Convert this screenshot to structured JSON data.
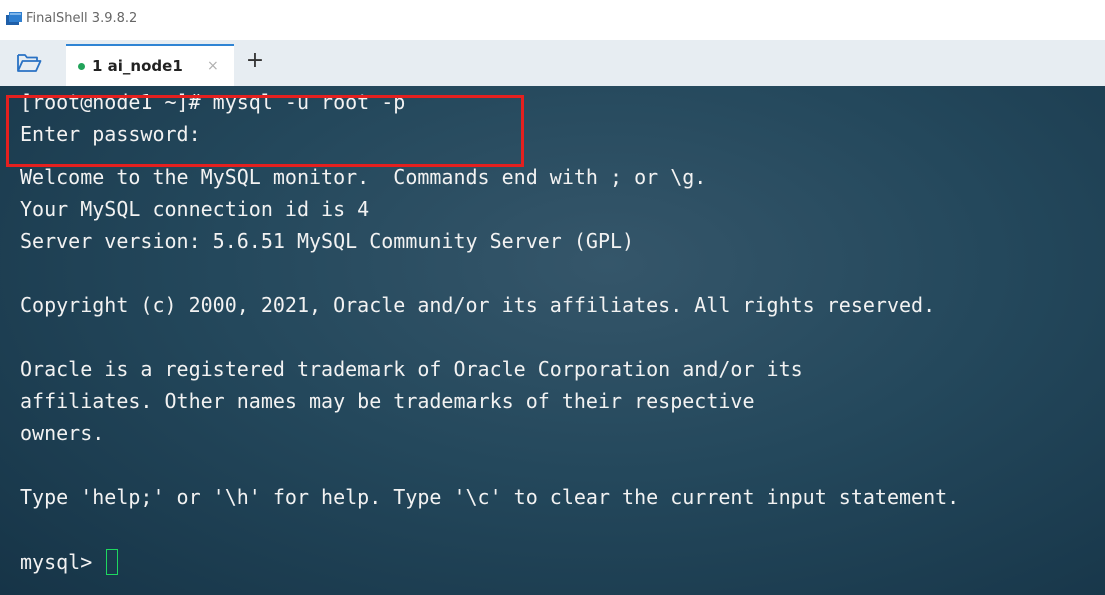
{
  "window": {
    "title": "FinalShell 3.9.8.2"
  },
  "tabs": [
    {
      "number": "1",
      "name": "ai_node1",
      "label": "1 ai_node1",
      "close_glyph": "×",
      "status_color": "#22a35a",
      "active": true
    }
  ],
  "tabbar": {
    "add_glyph": "+",
    "open_icon": "folder-open-icon"
  },
  "terminal": {
    "lines": [
      "[root@node1 ~]# mysql -u root -p",
      "Enter password:",
      "Welcome to the MySQL monitor.  Commands end with ; or \\g.",
      "Your MySQL connection id is 4",
      "Server version: 5.6.51 MySQL Community Server (GPL)",
      "",
      "Copyright (c) 2000, 2021, Oracle and/or its affiliates. All rights reserved.",
      "",
      "Oracle is a registered trademark of Oracle Corporation and/or its",
      "affiliates. Other names may be trademarks of their respective",
      "owners.",
      "",
      "Type 'help;' or '\\h' for help. Type '\\c' to clear the current input statement.",
      ""
    ],
    "prompt": "mysql> ",
    "cursor_color": "#1ed760",
    "highlight_color": "#e5201f"
  }
}
